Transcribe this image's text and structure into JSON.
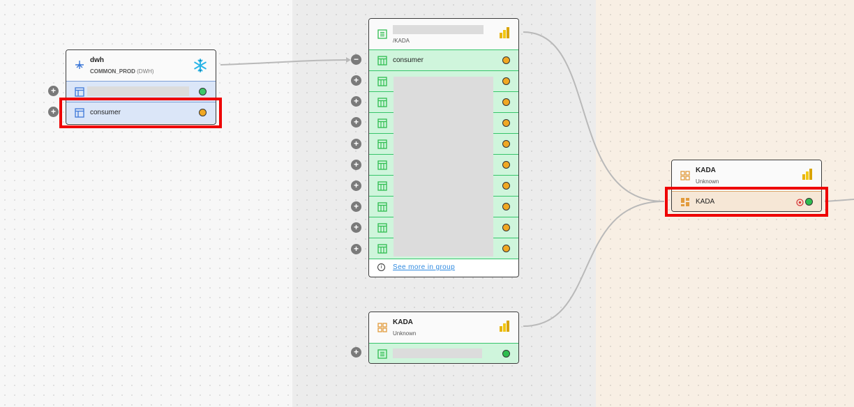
{
  "nodes": {
    "dwh": {
      "title": "dwh",
      "schema": "COMMON_PROD",
      "db": "(DWH)",
      "rows": [
        {
          "label": ""
        },
        {
          "label": "consumer"
        }
      ]
    },
    "kada_group": {
      "path": "/KADA",
      "first_row": "consumer",
      "see_more": "See more in group"
    },
    "kada_report_mid": {
      "title": "KADA",
      "subtitle": "Unknown"
    },
    "kada_report_right": {
      "title": "KADA",
      "subtitle": "Unknown",
      "row_label": "KADA"
    }
  },
  "icons": [
    "lineage-icon",
    "snowflake-icon",
    "table-icon",
    "dataset-icon",
    "powerbi-icon",
    "report-icon",
    "dashboard-icon",
    "target-icon",
    "info-icon",
    "plus-icon",
    "minus-icon"
  ],
  "colors": {
    "highlight": "#ee0000",
    "status_orange": "#f0a823",
    "status_green": "#3cc768",
    "row_blue": "#dbe6f8",
    "row_green": "#cff5dc",
    "row_tan": "#f6e7d6",
    "link": "#2f8ae0"
  }
}
